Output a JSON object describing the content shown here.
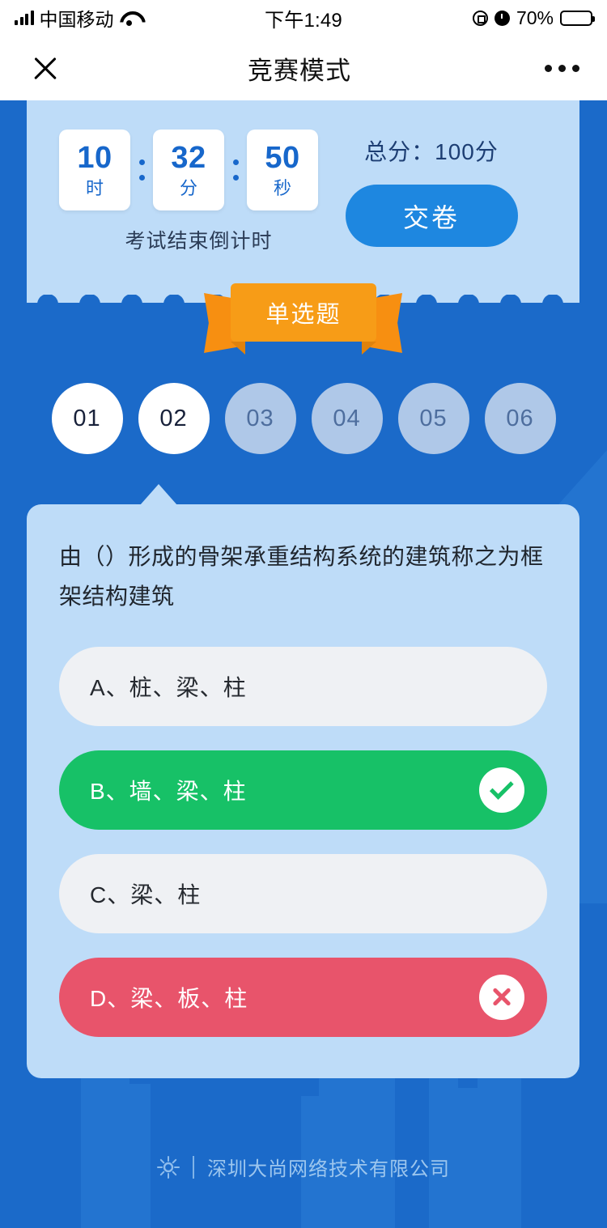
{
  "status_bar": {
    "carrier": "中国移动",
    "time": "下午1:49",
    "battery_percent": "70%",
    "signal_icon": "signal-bars-icon",
    "wifi_icon": "wifi-icon",
    "rotation_lock_icon": "rotation-lock-icon",
    "alarm_icon": "alarm-clock-icon",
    "battery_icon": "battery-icon"
  },
  "nav": {
    "title": "竞赛模式",
    "close_icon": "close-icon",
    "more_icon": "more-options-icon"
  },
  "header": {
    "countdown": {
      "hours": "10",
      "hours_unit": "时",
      "minutes": "32",
      "minutes_unit": "分",
      "seconds": "50",
      "seconds_unit": "秒",
      "label": "考试结束倒计时"
    },
    "total_score": "总分：100分",
    "submit_label": "交卷"
  },
  "ribbon": {
    "label": "单选题"
  },
  "question_nav": {
    "items": [
      {
        "label": "01",
        "state": "done"
      },
      {
        "label": "02",
        "state": "done"
      },
      {
        "label": "03",
        "state": "todo"
      },
      {
        "label": "04",
        "state": "todo"
      },
      {
        "label": "05",
        "state": "todo"
      },
      {
        "label": "06",
        "state": "todo"
      }
    ]
  },
  "question": {
    "text": "由（）形成的骨架承重结构系统的建筑称之为框架结构建筑",
    "options": [
      {
        "label": "A、桩、梁、柱",
        "state": "neutral",
        "mark": "none"
      },
      {
        "label": "B、墙、梁、柱",
        "state": "correct",
        "mark": "check-icon"
      },
      {
        "label": "C、梁、柱",
        "state": "neutral",
        "mark": "none"
      },
      {
        "label": "D、梁、板、柱",
        "state": "wrong",
        "mark": "cross-icon"
      }
    ]
  },
  "footer": {
    "logo_icon": "company-logo-icon",
    "company": "深圳大尚网络技术有限公司"
  },
  "colors": {
    "background_blue": "#1B6AC9",
    "panel_light_blue": "#BEDCF8",
    "accent_blue": "#1E87E0",
    "ribbon_orange": "#F79C17",
    "correct_green": "#17C167",
    "wrong_red": "#E8546B",
    "number_blue": "#1767CB"
  }
}
